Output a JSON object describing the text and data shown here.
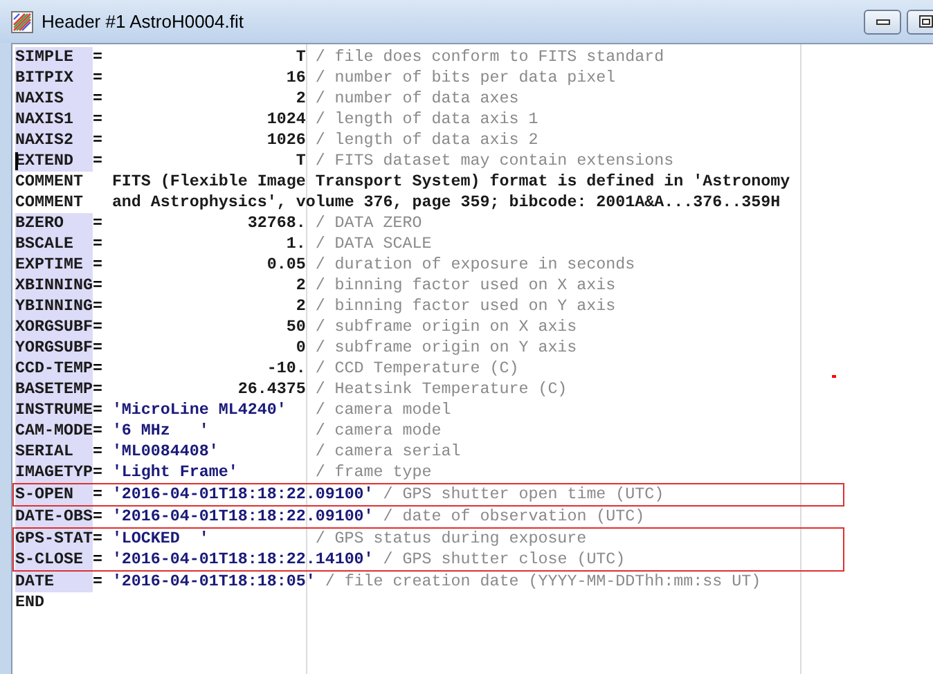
{
  "window": {
    "title": "Header #1 AstroH0004.fit",
    "controls": [
      {
        "kind": "minimize"
      },
      {
        "kind": "maximize"
      }
    ]
  },
  "lines": [
    {
      "kind": "number",
      "key": "SIMPLE",
      "sep": "=",
      "value": "T",
      "comment": "/ file does conform to FITS standard",
      "outlined": false,
      "cursor": false
    },
    {
      "kind": "number",
      "key": "BITPIX",
      "sep": "=",
      "value": "16",
      "comment": "/ number of bits per data pixel",
      "outlined": false,
      "cursor": false
    },
    {
      "kind": "number",
      "key": "NAXIS",
      "sep": "=",
      "value": "2",
      "comment": "/ number of data axes",
      "outlined": false,
      "cursor": false
    },
    {
      "kind": "number",
      "key": "NAXIS1",
      "sep": "=",
      "value": "1024",
      "comment": "/ length of data axis 1",
      "outlined": false,
      "cursor": false
    },
    {
      "kind": "number",
      "key": "NAXIS2",
      "sep": "=",
      "value": "1026",
      "comment": "/ length of data axis 2",
      "outlined": false,
      "cursor": false
    },
    {
      "kind": "number",
      "key": "EXTEND",
      "sep": "=",
      "value": "T",
      "comment": "/ FITS dataset may contain extensions",
      "outlined": false,
      "cursor": true
    },
    {
      "kind": "comment",
      "key": "COMMENT",
      "text": "FITS (Flexible Image Transport System) format is defined in 'Astronomy",
      "outlined": false,
      "cursor": false
    },
    {
      "kind": "comment",
      "key": "COMMENT",
      "text": "and Astrophysics', volume 376, page 359; bibcode: 2001A&A...376..359H",
      "outlined": false,
      "cursor": false
    },
    {
      "kind": "number",
      "key": "BZERO",
      "sep": "=",
      "value": "32768.",
      "comment": "/ DATA ZERO",
      "outlined": false,
      "cursor": false
    },
    {
      "kind": "number",
      "key": "BSCALE",
      "sep": "=",
      "value": "1.",
      "comment": "/ DATA SCALE",
      "outlined": false,
      "cursor": false
    },
    {
      "kind": "number",
      "key": "EXPTIME",
      "sep": "=",
      "value": "0.05",
      "comment": "/ duration of exposure in seconds",
      "outlined": false,
      "cursor": false
    },
    {
      "kind": "number",
      "key": "XBINNING",
      "sep": "=",
      "value": "2",
      "comment": "/ binning factor used on X axis",
      "outlined": false,
      "cursor": false
    },
    {
      "kind": "number",
      "key": "YBINNING",
      "sep": "=",
      "value": "2",
      "comment": "/ binning factor used on Y axis",
      "outlined": false,
      "cursor": false
    },
    {
      "kind": "number",
      "key": "XORGSUBF",
      "sep": "=",
      "value": "50",
      "comment": "/ subframe origin on X axis",
      "outlined": false,
      "cursor": false
    },
    {
      "kind": "number",
      "key": "YORGSUBF",
      "sep": "=",
      "value": "0",
      "comment": "/ subframe origin on Y axis",
      "outlined": false,
      "cursor": false
    },
    {
      "kind": "number",
      "key": "CCD-TEMP",
      "sep": "=",
      "value": "-10.",
      "comment": "/ CCD Temperature (C)",
      "outlined": false,
      "cursor": false
    },
    {
      "kind": "number",
      "key": "BASETEMP",
      "sep": "=",
      "value": "26.4375",
      "comment": "/ Heatsink Temperature (C)",
      "outlined": false,
      "cursor": false
    },
    {
      "kind": "string",
      "key": "INSTRUME",
      "sep": "=",
      "value": "'MicroLine ML4240'",
      "comment": "/ camera model",
      "outlined": false,
      "cursor": false
    },
    {
      "kind": "string",
      "key": "CAM-MODE",
      "sep": "=",
      "value": "'6 MHz   '",
      "comment": "/ camera mode",
      "outlined": false,
      "cursor": false
    },
    {
      "kind": "string",
      "key": "SERIAL",
      "sep": "=",
      "value": "'ML0084408'",
      "comment": "/ camera serial",
      "outlined": false,
      "cursor": false
    },
    {
      "kind": "string",
      "key": "IMAGETYP",
      "sep": "=",
      "value": "'Light Frame'",
      "comment": "/ frame type",
      "outlined": false,
      "cursor": false
    },
    {
      "kind": "string",
      "key": "S-OPEN",
      "sep": "=",
      "value": "'2016-04-01T18:18:22.09100'",
      "comment": "/ GPS shutter open time (UTC)",
      "outlined": true,
      "cursor": false
    },
    {
      "kind": "string",
      "key": "DATE-OBS",
      "sep": "=",
      "value": "'2016-04-01T18:18:22.09100'",
      "comment": "/ date of observation (UTC)",
      "outlined": false,
      "cursor": false
    },
    {
      "kind": "string",
      "key": "GPS-STAT",
      "sep": "=",
      "value": "'LOCKED  '",
      "comment": "/ GPS status during exposure",
      "outlined": true,
      "cursor": false
    },
    {
      "kind": "string",
      "key": "S-CLOSE",
      "sep": "=",
      "value": "'2016-04-01T18:18:22.14100'",
      "comment": "/ GPS shutter close (UTC)",
      "outlined": true,
      "cursor": false
    },
    {
      "kind": "string",
      "key": "DATE",
      "sep": "=",
      "value": "'2016-04-01T18:18:05'",
      "comment": "/ file creation date (YYYY-MM-DDThh:mm:ss UT)",
      "outlined": false,
      "cursor": false
    },
    {
      "kind": "end",
      "key": "END",
      "outlined": false,
      "cursor": false
    }
  ]
}
